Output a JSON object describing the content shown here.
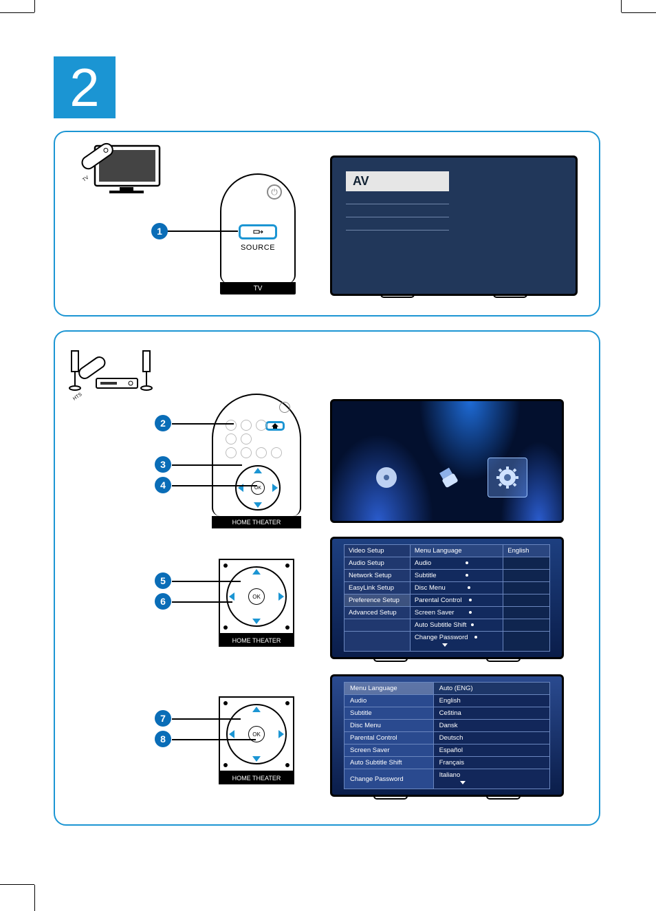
{
  "step_number": "2",
  "panel1": {
    "callout1": "1",
    "remote": {
      "source_label": "SOURCE",
      "device_label": "TV"
    },
    "screen": {
      "selected_source": "AV"
    },
    "tv_icon_label": "TV"
  },
  "panel2": {
    "ht_icon_label": "HTS",
    "callout2": "2",
    "callout3": "3",
    "callout4": "4",
    "callout5": "5",
    "callout6": "6",
    "callout7": "7",
    "callout8": "8",
    "remote2": {
      "ok": "OK",
      "device_label": "HOME  THEATER"
    },
    "dpad": {
      "ok": "OK",
      "device_label": "HOME  THEATER"
    },
    "screenA_icons": [
      "disc-icon",
      "usb-icon",
      "settings-icon"
    ],
    "screenB": {
      "left_col": [
        "Video Setup",
        "Audio Setup",
        "Network Setup",
        "EasyLink Setup",
        "Preference Setup",
        "Advanced Setup"
      ],
      "selected_left_index": 4,
      "mid_col": [
        "Menu Language",
        "Audio",
        "Subtitle",
        "Disc Menu",
        "Parental Control",
        "Screen Saver",
        "Auto Subtitle Shift",
        "Change Password"
      ],
      "right_value": "English"
    },
    "screenC": {
      "left_col": [
        "Menu Language",
        "Audio",
        "Subtitle",
        "Disc Menu",
        "Parental Control",
        "Screen Saver",
        "Auto Subtitle Shift",
        "Change Password"
      ],
      "right_col": [
        "Auto (ENG)",
        "English",
        "Ceština",
        "Dansk",
        "Deutsch",
        "Español",
        "Français",
        "Italiano"
      ],
      "selected_left_index": 0,
      "selected_right_index": 0
    }
  }
}
